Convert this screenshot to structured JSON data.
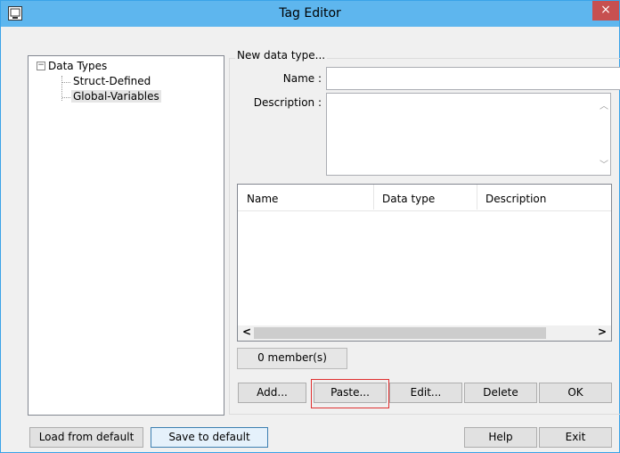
{
  "window": {
    "title": "Tag Editor",
    "close_label": "×"
  },
  "tree": {
    "expander": "−",
    "root_label": "Data Types",
    "children": [
      "Struct-Defined",
      "Global-Variables"
    ]
  },
  "form": {
    "group_label": "New data type...",
    "name_label": "Name :",
    "name_value": "",
    "description_label": "Description :",
    "description_value": ""
  },
  "members_table": {
    "columns": [
      "Name",
      "Data type",
      "Description"
    ],
    "rows": [],
    "scroll_left": "<",
    "scroll_right": ">"
  },
  "status_text": "0 member(s)",
  "buttons": {
    "add": "Add...",
    "paste": "Paste...",
    "edit": "Edit...",
    "delete": "Delete",
    "ok": "OK",
    "load_default": "Load from default",
    "save_default": "Save to default",
    "help": "Help",
    "exit": "Exit"
  },
  "colors": {
    "titlebar": "#5eb6ee",
    "close": "#c75050",
    "highlight": "#e03030"
  }
}
